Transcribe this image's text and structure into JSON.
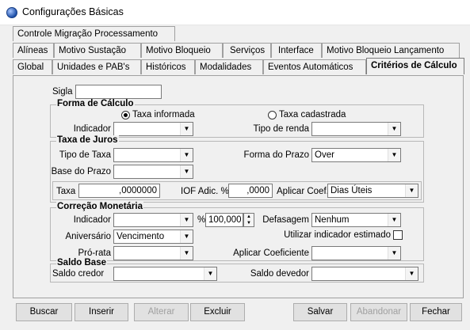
{
  "window": {
    "title": "Configurações Básicas"
  },
  "tabs": {
    "row1": [
      "Controle Migração Processamento"
    ],
    "row2": [
      "Alíneas",
      "Motivo Sustação",
      "Motivo Bloqueio",
      "Serviços",
      "Interface",
      "Motivo Bloqueio Lançamento"
    ],
    "row3": [
      "Global",
      "Unidades e PAB's",
      "Históricos",
      "Modalidades",
      "Eventos Automáticos",
      "Critérios de Cálculo"
    ],
    "active": "Critérios de Cálculo"
  },
  "form": {
    "sigla": {
      "label": "Sigla",
      "value": ""
    },
    "forma_calculo": {
      "title": "Forma de Cálculo",
      "radio_informada": "Taxa informada",
      "radio_cadastrada": "Taxa cadastrada",
      "selected": "Taxa informada",
      "indicador_label": "Indicador",
      "indicador_value": "",
      "tipo_renda_label": "Tipo de renda",
      "tipo_renda_value": ""
    },
    "taxa_juros": {
      "title": "Taxa de Juros",
      "tipo_taxa_label": "Tipo de Taxa",
      "tipo_taxa_value": "",
      "forma_prazo_label": "Forma do Prazo",
      "forma_prazo_value": "Over",
      "base_prazo_label": "Base do Prazo",
      "base_prazo_value": "",
      "taxa_label": "Taxa",
      "taxa_value": ",0000000",
      "iof_label": "IOF Adic. %",
      "iof_value": ",0000",
      "aplicar_coef_label": "Aplicar Coef.",
      "aplicar_coef_value": "Dias Úteis"
    },
    "correcao": {
      "title": "Correção Monetária",
      "indicador_label": "Indicador",
      "indicador_value": "",
      "percent_label": "%",
      "percent_value": "100,000",
      "defasagem_label": "Defasagem",
      "defasagem_value": "Nenhum",
      "aniversario_label": "Aniversário",
      "aniversario_value": "Vencimento",
      "utilizar_label": "Utilizar indicador estimado",
      "pro_rata_label": "Pró-rata",
      "pro_rata_value": "",
      "aplicar_coef_label": "Aplicar Coeficiente",
      "aplicar_coef_value": ""
    },
    "saldo_base": {
      "title": "Saldo Base",
      "credor_label": "Saldo credor",
      "credor_value": "",
      "devedor_label": "Saldo devedor",
      "devedor_value": ""
    }
  },
  "buttons": {
    "buscar": "Buscar",
    "inserir": "Inserir",
    "alterar": "Alterar",
    "excluir": "Excluir",
    "salvar": "Salvar",
    "abandonar": "Abandonar",
    "fechar": "Fechar"
  },
  "icons": {
    "app": "app-globe-icon",
    "dropdown": "chevron-down-icon"
  }
}
